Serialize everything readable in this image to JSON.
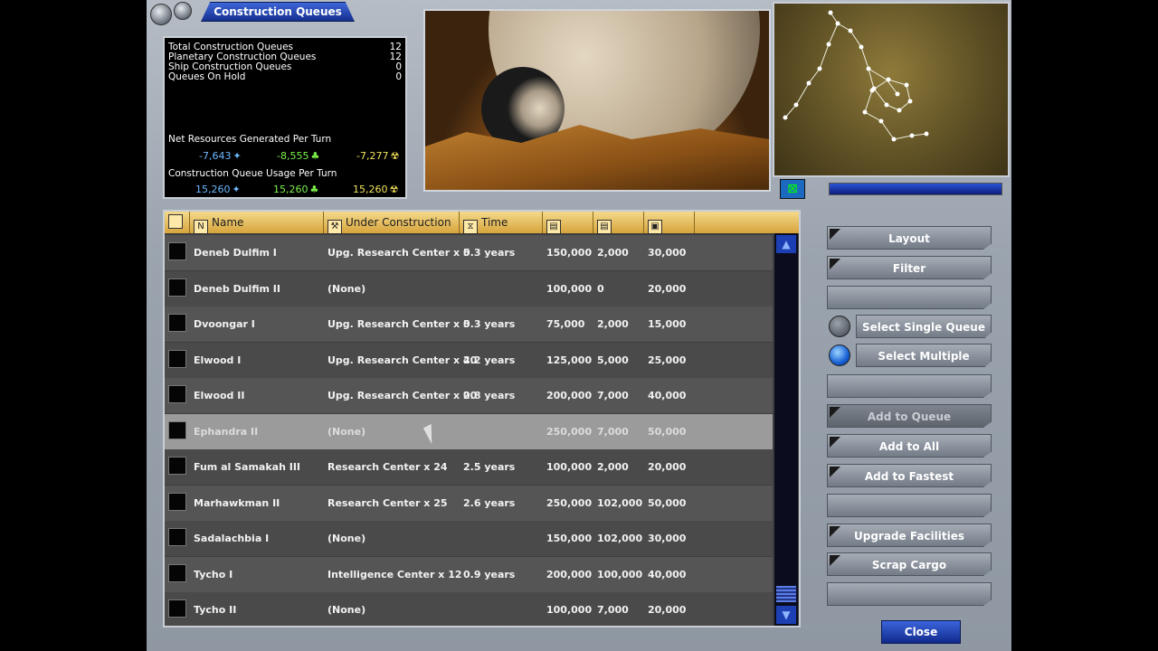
{
  "window": {
    "title": "Construction Queues"
  },
  "stats": {
    "rows": [
      {
        "label": "Total Construction Queues",
        "value": "12"
      },
      {
        "label": "Planetary Construction Queues",
        "value": "12"
      },
      {
        "label": "Ship Construction Queues",
        "value": "0"
      },
      {
        "label": "Queues On Hold",
        "value": "0"
      }
    ],
    "net_title": "Net Resources Generated Per Turn",
    "net": {
      "minerals": "-7,643",
      "organics": "-8,555",
      "radioactives": "-7,277"
    },
    "usage_title": "Construction Queue Usage Per Turn",
    "usage": {
      "minerals": "15,260",
      "organics": "15,260",
      "radioactives": "15,260"
    }
  },
  "table": {
    "headers": {
      "name": "Name",
      "under_construction": "Under Construction",
      "time": "Time"
    },
    "rows": [
      {
        "name": "Deneb Dulfim I",
        "construction": "Upg. Research Center x 5",
        "time": "0.3 years",
        "c1": "150,000",
        "c2": "2,000",
        "c3": "30,000"
      },
      {
        "name": "Deneb Dulfim II",
        "construction": "(None)",
        "time": "",
        "c1": "100,000",
        "c2": "0",
        "c3": "20,000"
      },
      {
        "name": "Dvoongar I",
        "construction": "Upg. Research Center x 5",
        "time": "0.3 years",
        "c1": "75,000",
        "c2": "2,000",
        "c3": "15,000"
      },
      {
        "name": "Elwood I",
        "construction": "Upg. Research Center x 40",
        "time": "2.2 years",
        "c1": "125,000",
        "c2": "5,000",
        "c3": "25,000"
      },
      {
        "name": "Elwood II",
        "construction": "Upg. Research Center x 20",
        "time": "0.8 years",
        "c1": "200,000",
        "c2": "7,000",
        "c3": "40,000"
      },
      {
        "name": "Ephandra II",
        "construction": "(None)",
        "time": "",
        "c1": "250,000",
        "c2": "7,000",
        "c3": "50,000"
      },
      {
        "name": "Fum al Samakah III",
        "construction": "Research Center x 24",
        "time": "2.5 years",
        "c1": "100,000",
        "c2": "2,000",
        "c3": "20,000"
      },
      {
        "name": "Marhawkman II",
        "construction": "Research Center x 25",
        "time": "2.6 years",
        "c1": "250,000",
        "c2": "102,000",
        "c3": "50,000"
      },
      {
        "name": "Sadalachbia I",
        "construction": "(None)",
        "time": "",
        "c1": "150,000",
        "c2": "102,000",
        "c3": "30,000"
      },
      {
        "name": "Tycho I",
        "construction": "Intelligence Center x 12",
        "time": "0.9 years",
        "c1": "200,000",
        "c2": "100,000",
        "c3": "40,000"
      },
      {
        "name": "Tycho II",
        "construction": "(None)",
        "time": "",
        "c1": "100,000",
        "c2": "7,000",
        "c3": "20,000"
      }
    ]
  },
  "buttons": {
    "layout": "Layout",
    "filter": "Filter",
    "select_single": "Select Single Queue",
    "select_multiple": "Select Multiple Queues",
    "add_to_queue": "Add to Queue",
    "add_to_all": "Add to All",
    "add_to_fastest": "Add to Fastest",
    "upgrade_facilities": "Upgrade Facilities",
    "scrap_cargo": "Scrap Cargo",
    "close": "Close"
  }
}
